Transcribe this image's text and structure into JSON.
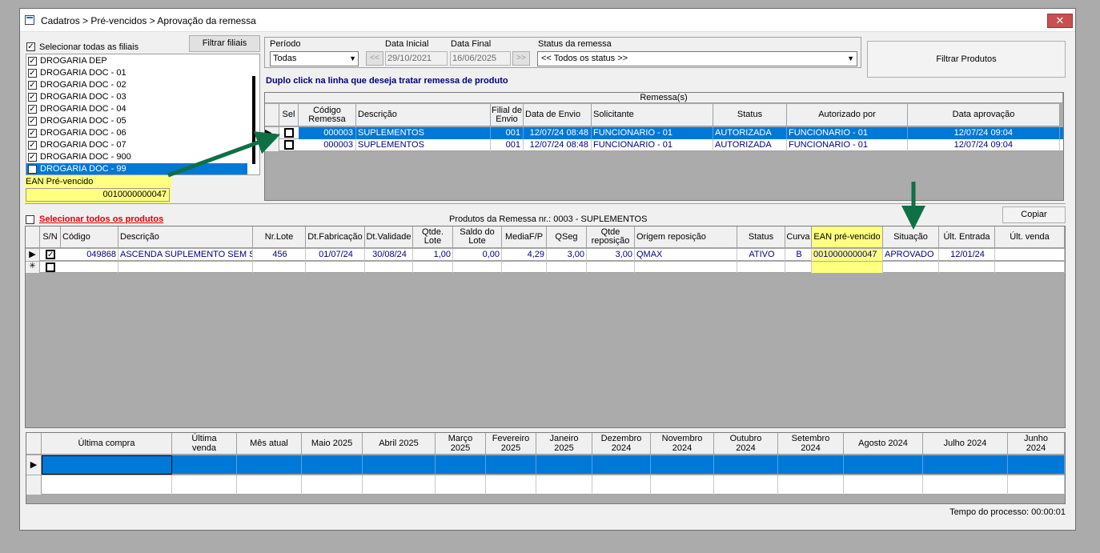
{
  "window": {
    "title": "Cadatros > Pré-vencidos > Aprovação da remessa",
    "close": "✕"
  },
  "filiais": {
    "select_all_label": "Selecionar todas as filiais",
    "filter_button": "Filtrar filiais",
    "items": [
      "DROGARIA DEP",
      "DROGARIA DOC - 01",
      "DROGARIA DOC - 02",
      "DROGARIA DOC - 03",
      "DROGARIA DOC - 04",
      "DROGARIA DOC - 05",
      "DROGARIA DOC - 06",
      "DROGARIA DOC - 07",
      "DROGARIA DOC - 900",
      "DROGARIA DOC - 99"
    ],
    "selected_index": 9
  },
  "ean": {
    "label": "EAN Pré-vencido",
    "value": "0010000000047"
  },
  "filters": {
    "periodo_label": "Período",
    "periodo_value": "Todas",
    "data_inicial_label": "Data Inicial",
    "data_inicial_value": "29/10/2021",
    "data_final_label": "Data Final",
    "data_final_value": "16/06/2025",
    "prev": "<<",
    "next": ">>",
    "status_label": "Status da remessa",
    "status_value": "<< Todos os status >>",
    "filtrar_produtos": "Filtrar Produtos"
  },
  "hint": "Duplo click na linha que deseja tratar remessa de produto",
  "remessas": {
    "title": "Remessa(s)",
    "headers": [
      "Sel",
      "Código Remessa",
      "Descrição",
      "Filial de Envio",
      "Data de Envio",
      "Solicitante",
      "Status",
      "Autorizado por",
      "Data aprovação"
    ],
    "rows": [
      [
        "000003",
        "SUPLEMENTOS",
        "001",
        "12/07/24 08:48",
        "FUNCIONARIO - 01",
        "AUTORIZADA",
        "FUNCIONARIO - 01",
        "12/07/24 09:04"
      ],
      [
        "000003",
        "SUPLEMENTOS",
        "001",
        "12/07/24 08:48",
        "FUNCIONARIO - 01",
        "AUTORIZADA",
        "FUNCIONARIO - 01",
        "12/07/24 09:04"
      ]
    ]
  },
  "produtos": {
    "select_all": "Selecionar todos os produtos",
    "title": "Produtos da Remessa nr.: 0003 - SUPLEMENTOS",
    "copiar": "Copiar",
    "headers": [
      "S/N",
      "Código",
      "Descrição",
      "Nr.Lote",
      "Dt.Fabricação",
      "Dt.Validade",
      "Qtde. Lote",
      "Saldo do Lote",
      "MediaF/P",
      "QSeg",
      "Qtde reposição",
      "Origem reposição",
      "Status",
      "Curva",
      "EAN pré-vencido",
      "Situação",
      "Últ. Entrada",
      "Últ. venda"
    ],
    "row": [
      "049868",
      "ASCENDA SUPLEMENTO SEM S",
      "456",
      "01/07/24",
      "30/08/24",
      "1,00",
      "0,00",
      "4,29",
      "3,00",
      "3,00",
      "QMAX",
      "ATIVO",
      "B",
      "0010000000047",
      "APROVADO",
      "12/01/24",
      ""
    ],
    "new_row_marker": "✳"
  },
  "historico": {
    "headers": [
      "Última compra",
      "Última venda",
      "Mês atual",
      "Maio 2025",
      "Abril 2025",
      "Março 2025",
      "Fevereiro 2025",
      "Janeiro 2025",
      "Dezembro 2024",
      "Novembro 2024",
      "Outubro 2024",
      "Setembro 2024",
      "Agosto 2024",
      "Julho 2024",
      "Junho 2024"
    ]
  },
  "status_bar": "Tempo do processo: 00:00:01",
  "colors": {
    "highlight": "#0078d7",
    "ean_yellow": "#ffff80",
    "arrow_green": "#0f7045",
    "red_text": "#e00000",
    "data_blue": "#000080"
  }
}
